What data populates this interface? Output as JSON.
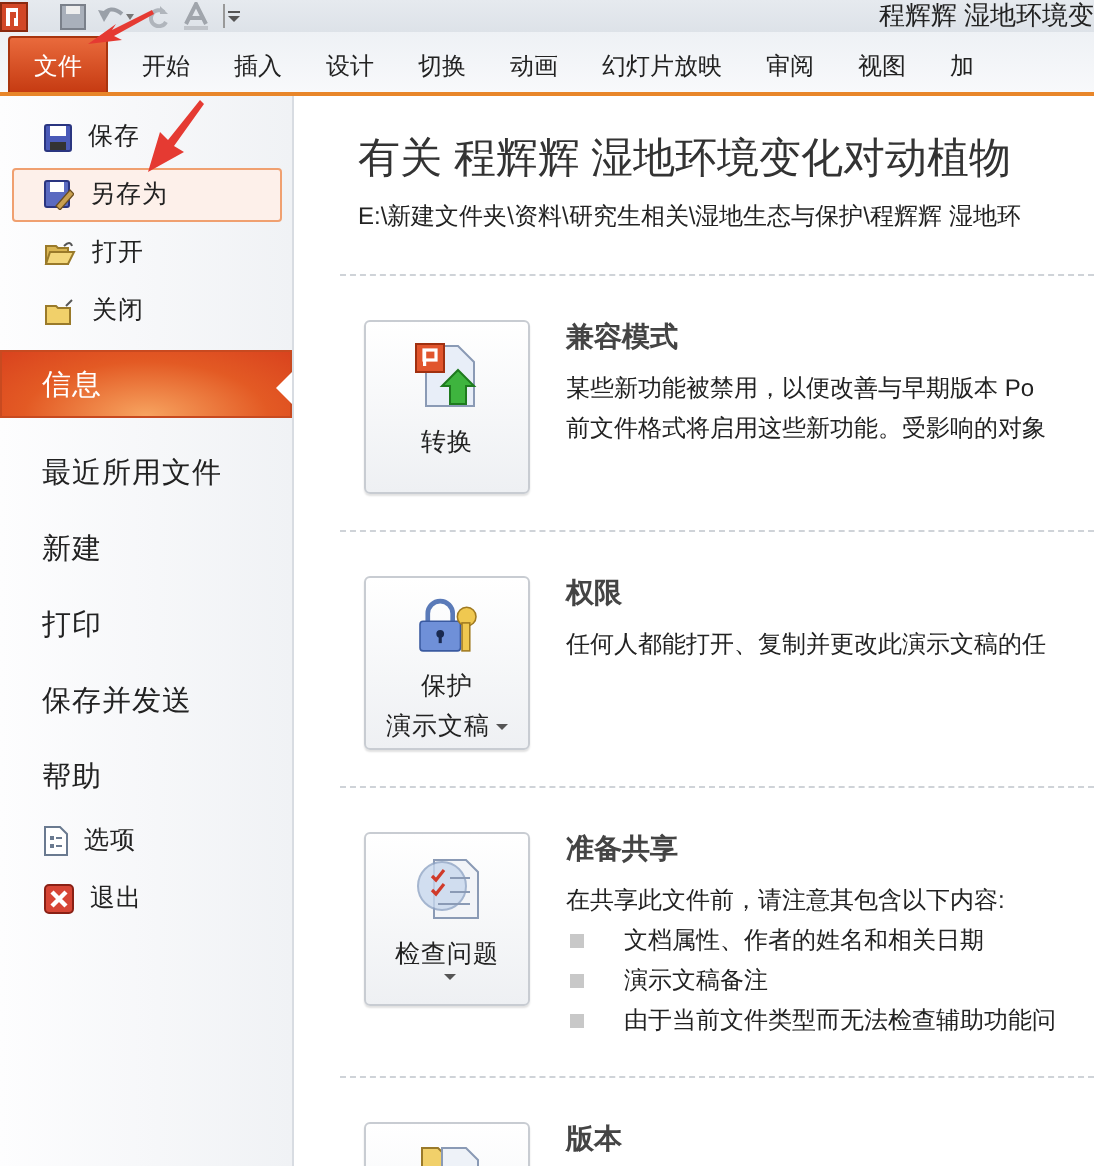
{
  "window": {
    "title": "程辉辉 湿地环境变"
  },
  "ribbon_tabs": [
    {
      "label": "文件",
      "selected": true
    },
    {
      "label": "开始",
      "selected": false
    },
    {
      "label": "插入",
      "selected": false
    },
    {
      "label": "设计",
      "selected": false
    },
    {
      "label": "切换",
      "selected": false
    },
    {
      "label": "动画",
      "selected": false
    },
    {
      "label": "幻灯片放映",
      "selected": false
    },
    {
      "label": "审阅",
      "selected": false
    },
    {
      "label": "视图",
      "selected": false
    },
    {
      "label": "加",
      "selected": false
    }
  ],
  "sidebar": {
    "items": [
      {
        "kind": "command",
        "label": "保存",
        "selected": false,
        "hovered": false
      },
      {
        "kind": "command",
        "label": "另存为",
        "selected": false,
        "hovered": true
      },
      {
        "kind": "command",
        "label": "打开",
        "selected": false,
        "hovered": false
      },
      {
        "kind": "command",
        "label": "关闭",
        "selected": false,
        "hovered": false
      },
      {
        "kind": "page",
        "label": "信息",
        "selected": true,
        "hovered": false
      },
      {
        "kind": "page",
        "label": "最近所用文件",
        "selected": false,
        "hovered": false
      },
      {
        "kind": "page",
        "label": "新建",
        "selected": false,
        "hovered": false
      },
      {
        "kind": "page",
        "label": "打印",
        "selected": false,
        "hovered": false
      },
      {
        "kind": "page",
        "label": "保存并发送",
        "selected": false,
        "hovered": false
      },
      {
        "kind": "page",
        "label": "帮助",
        "selected": false,
        "hovered": false
      },
      {
        "kind": "command",
        "label": "选项",
        "selected": false,
        "hovered": false
      },
      {
        "kind": "command",
        "label": "退出",
        "selected": false,
        "hovered": false
      }
    ]
  },
  "info": {
    "title": "有关 程辉辉 湿地环境变化对动植物",
    "path": "E:\\新建文件夹\\资料\\研究生相关\\湿地生态与保护\\程辉辉 湿地环",
    "sections": [
      {
        "heading": "兼容模式",
        "button": {
          "label_lines": [
            "转换"
          ],
          "dropdown": false
        },
        "lines": [
          "某些新功能被禁用，以便改善与早期版本 Po",
          "前文件格式将启用这些新功能。受影响的对象"
        ]
      },
      {
        "heading": "权限",
        "button": {
          "label_lines": [
            "保护",
            "演示文稿"
          ],
          "dropdown": true
        },
        "lines": [
          "任何人都能打开、复制并更改此演示文稿的任"
        ]
      },
      {
        "heading": "准备共享",
        "button": {
          "label_lines": [
            "检查问题"
          ],
          "dropdown": true
        },
        "lines": [
          "在共享此文件前，请注意其包含以下内容:"
        ],
        "bullets": [
          "文档属性、作者的姓名和相关日期",
          "演示文稿备注",
          "由于当前文件类型而无法检查辅助功能问"
        ]
      },
      {
        "heading": "版本",
        "button": {
          "dropdown": false
        }
      }
    ]
  }
}
